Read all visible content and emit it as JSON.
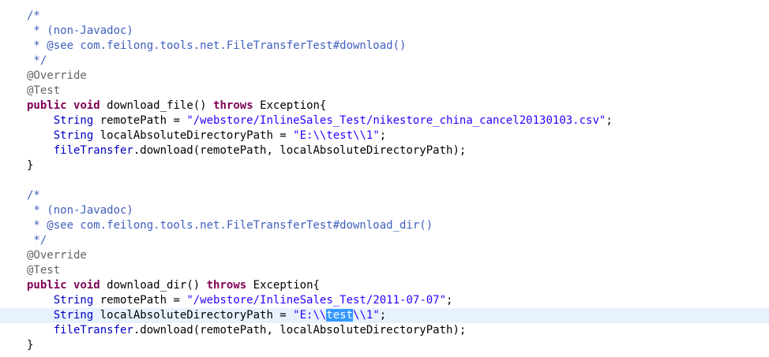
{
  "editor": {
    "block1": {
      "c_open": "/*",
      "c_line1": " * (non-Javadoc)",
      "c_line2": " * @see com.feilong.tools.net.FileTransferTest#download()",
      "c_close": " */",
      "ann1": "@Override",
      "ann2": "@Test",
      "kw_public": "public",
      "kw_void": "void",
      "method": "download_file()",
      "kw_throws": "throws",
      "exception": "Exception{",
      "type1": "String",
      "var1": "remotePath = ",
      "str1": "\"/webstore/InlineSales_Test/nikestore_china_cancel20130103.csv\"",
      "semi1": ";",
      "type2": "String",
      "var2": "localAbsoluteDirectoryPath = ",
      "str2": "\"E:\\\\test\\\\1\"",
      "semi2": ";",
      "field": "fileTransfer",
      "call": ".download(remotePath, localAbsoluteDirectoryPath);",
      "close": "}"
    },
    "block2": {
      "c_open": "/*",
      "c_line1": " * (non-Javadoc)",
      "c_line2": " * @see com.feilong.tools.net.FileTransferTest#download_dir()",
      "c_close": " */",
      "ann1": "@Override",
      "ann2": "@Test",
      "kw_public": "public",
      "kw_void": "void",
      "method": "download_dir()",
      "kw_throws": "throws",
      "exception": "Exception{",
      "type1": "String",
      "var1": "remotePath = ",
      "str1": "\"/webstore/InlineSales_Test/2011-07-07\"",
      "semi1": ";",
      "type2": "String",
      "var2": "localAbsoluteDirectoryPath = ",
      "str2_pre": "\"E:\\\\",
      "str2_sel": "test",
      "str2_post": "\\\\1\"",
      "semi2": ";",
      "field": "fileTransfer",
      "call": ".download(remotePath, localAbsoluteDirectoryPath);",
      "close": "}"
    }
  }
}
